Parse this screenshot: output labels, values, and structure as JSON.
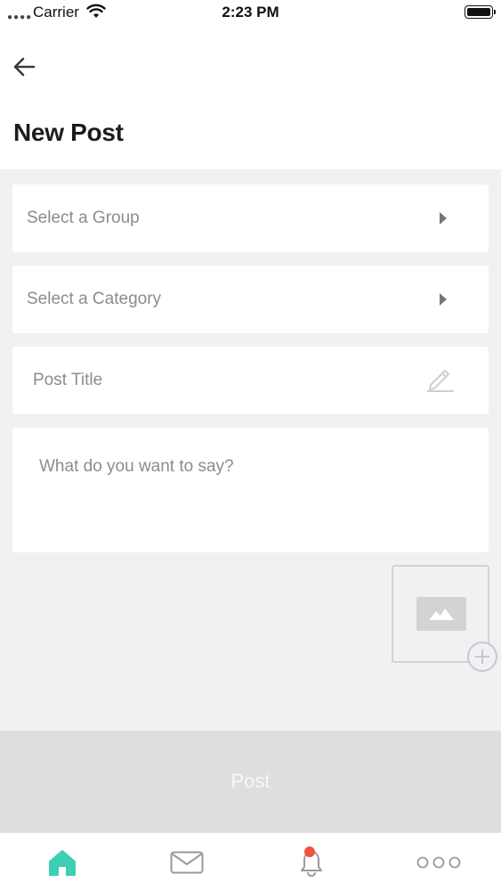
{
  "status_bar": {
    "carrier": "Carrier",
    "time": "2:23 PM",
    "signal_icon": "signal-dots-icon",
    "wifi_icon": "wifi-icon",
    "battery_icon": "battery-icon"
  },
  "header": {
    "back_icon": "arrow-left-icon",
    "title": "New Post"
  },
  "form": {
    "group": {
      "placeholder": "Select a Group",
      "icon": "caret-right-icon"
    },
    "category": {
      "placeholder": "Select a Category",
      "icon": "caret-right-icon"
    },
    "post_title": {
      "placeholder": "Post Title",
      "value": "",
      "icon": "pencil-icon"
    },
    "body": {
      "placeholder": "What do you want to say?",
      "value": ""
    },
    "image_add": {
      "icon": "image-icon",
      "add_icon": "plus-circle-icon"
    }
  },
  "post_button": {
    "label": "Post"
  },
  "tab_bar": {
    "items": [
      {
        "name": "home",
        "icon": "home-icon",
        "active": true
      },
      {
        "name": "messages",
        "icon": "envelope-icon",
        "active": false
      },
      {
        "name": "notifications",
        "icon": "bell-icon",
        "active": false,
        "badge": true
      },
      {
        "name": "more",
        "icon": "more-dots-icon",
        "active": false
      }
    ]
  },
  "colors": {
    "accent": "#3ccfb4",
    "badge": "#f0523c",
    "form_background": "#f0f1f3",
    "disabled_button": "#dedee0"
  }
}
